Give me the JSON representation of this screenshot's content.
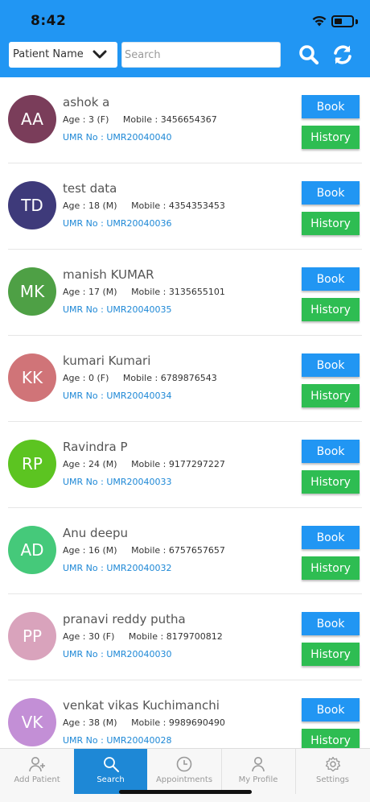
{
  "status_bar": {
    "time": "8:42"
  },
  "header": {
    "filter": {
      "selected": "Patient Name"
    },
    "search": {
      "placeholder": "Search",
      "value": ""
    }
  },
  "patients": [
    {
      "initials": "AA",
      "color": "#7a3d5a",
      "name": "ashok a",
      "age_label": "Age :",
      "age": "3",
      "gender": "(F)",
      "mobile_label": "Mobile :",
      "mobile": "3456654367",
      "umr_label": "UMR No :",
      "umr": "UMR20040040",
      "book_label": "Book",
      "history_label": "History"
    },
    {
      "initials": "TD",
      "color": "#3e3a7a",
      "name": "test data",
      "age_label": "Age :",
      "age": "18",
      "gender": "(M)",
      "mobile_label": "Mobile :",
      "mobile": "4354353453",
      "umr_label": "UMR No :",
      "umr": "UMR20040036",
      "book_label": "Book",
      "history_label": "History"
    },
    {
      "initials": "MK",
      "color": "#4ea045",
      "name": "manish KUMAR",
      "age_label": "Age :",
      "age": "17",
      "gender": "(M)",
      "mobile_label": "Mobile :",
      "mobile": "3135655101",
      "umr_label": "UMR No :",
      "umr": "UMR20040035",
      "book_label": "Book",
      "history_label": "History"
    },
    {
      "initials": "KK",
      "color": "#d07478",
      "name": "kumari Kumari",
      "age_label": "Age :",
      "age": "0",
      "gender": "(F)",
      "mobile_label": "Mobile :",
      "mobile": "6789876543",
      "umr_label": "UMR No :",
      "umr": "UMR20040034",
      "book_label": "Book",
      "history_label": "History"
    },
    {
      "initials": "RP",
      "color": "#5cc421",
      "name": "Ravindra  P",
      "age_label": "Age :",
      "age": "24",
      "gender": "(M)",
      "mobile_label": "Mobile :",
      "mobile": "9177297227",
      "umr_label": "UMR No :",
      "umr": "UMR20040033",
      "book_label": "Book",
      "history_label": "History"
    },
    {
      "initials": "AD",
      "color": "#45c97a",
      "name": "Anu deepu",
      "age_label": "Age :",
      "age": "16",
      "gender": "(M)",
      "mobile_label": "Mobile :",
      "mobile": "6757657657",
      "umr_label": "UMR No :",
      "umr": "UMR20040032",
      "book_label": "Book",
      "history_label": "History"
    },
    {
      "initials": "PP",
      "color": "#d9a3bc",
      "name": "pranavi reddy putha",
      "age_label": "Age :",
      "age": "30",
      "gender": "(F)",
      "mobile_label": "Mobile :",
      "mobile": "8179700812",
      "umr_label": "UMR No :",
      "umr": "UMR20040030",
      "book_label": "Book",
      "history_label": "History"
    },
    {
      "initials": "VK",
      "color": "#c38fd6",
      "name": "venkat vikas Kuchimanchi",
      "age_label": "Age :",
      "age": "38",
      "gender": "(M)",
      "mobile_label": "Mobile :",
      "mobile": "9989690490",
      "umr_label": "UMR No :",
      "umr": "UMR20040028",
      "book_label": "Book",
      "history_label": "History"
    }
  ],
  "tabs": [
    {
      "label": "Add Patient",
      "icon": "add-user-icon",
      "active": false
    },
    {
      "label": "Search",
      "icon": "search-icon",
      "active": true
    },
    {
      "label": "Appointments",
      "icon": "clock-icon",
      "active": false
    },
    {
      "label": "My Profile",
      "icon": "user-icon",
      "active": false
    },
    {
      "label": "Settings",
      "icon": "gear-icon",
      "active": false
    }
  ],
  "colors": {
    "primary": "#2196f3",
    "history": "#2ebd52",
    "umr": "#1e88d6",
    "active_tab": "#1e88d6"
  }
}
